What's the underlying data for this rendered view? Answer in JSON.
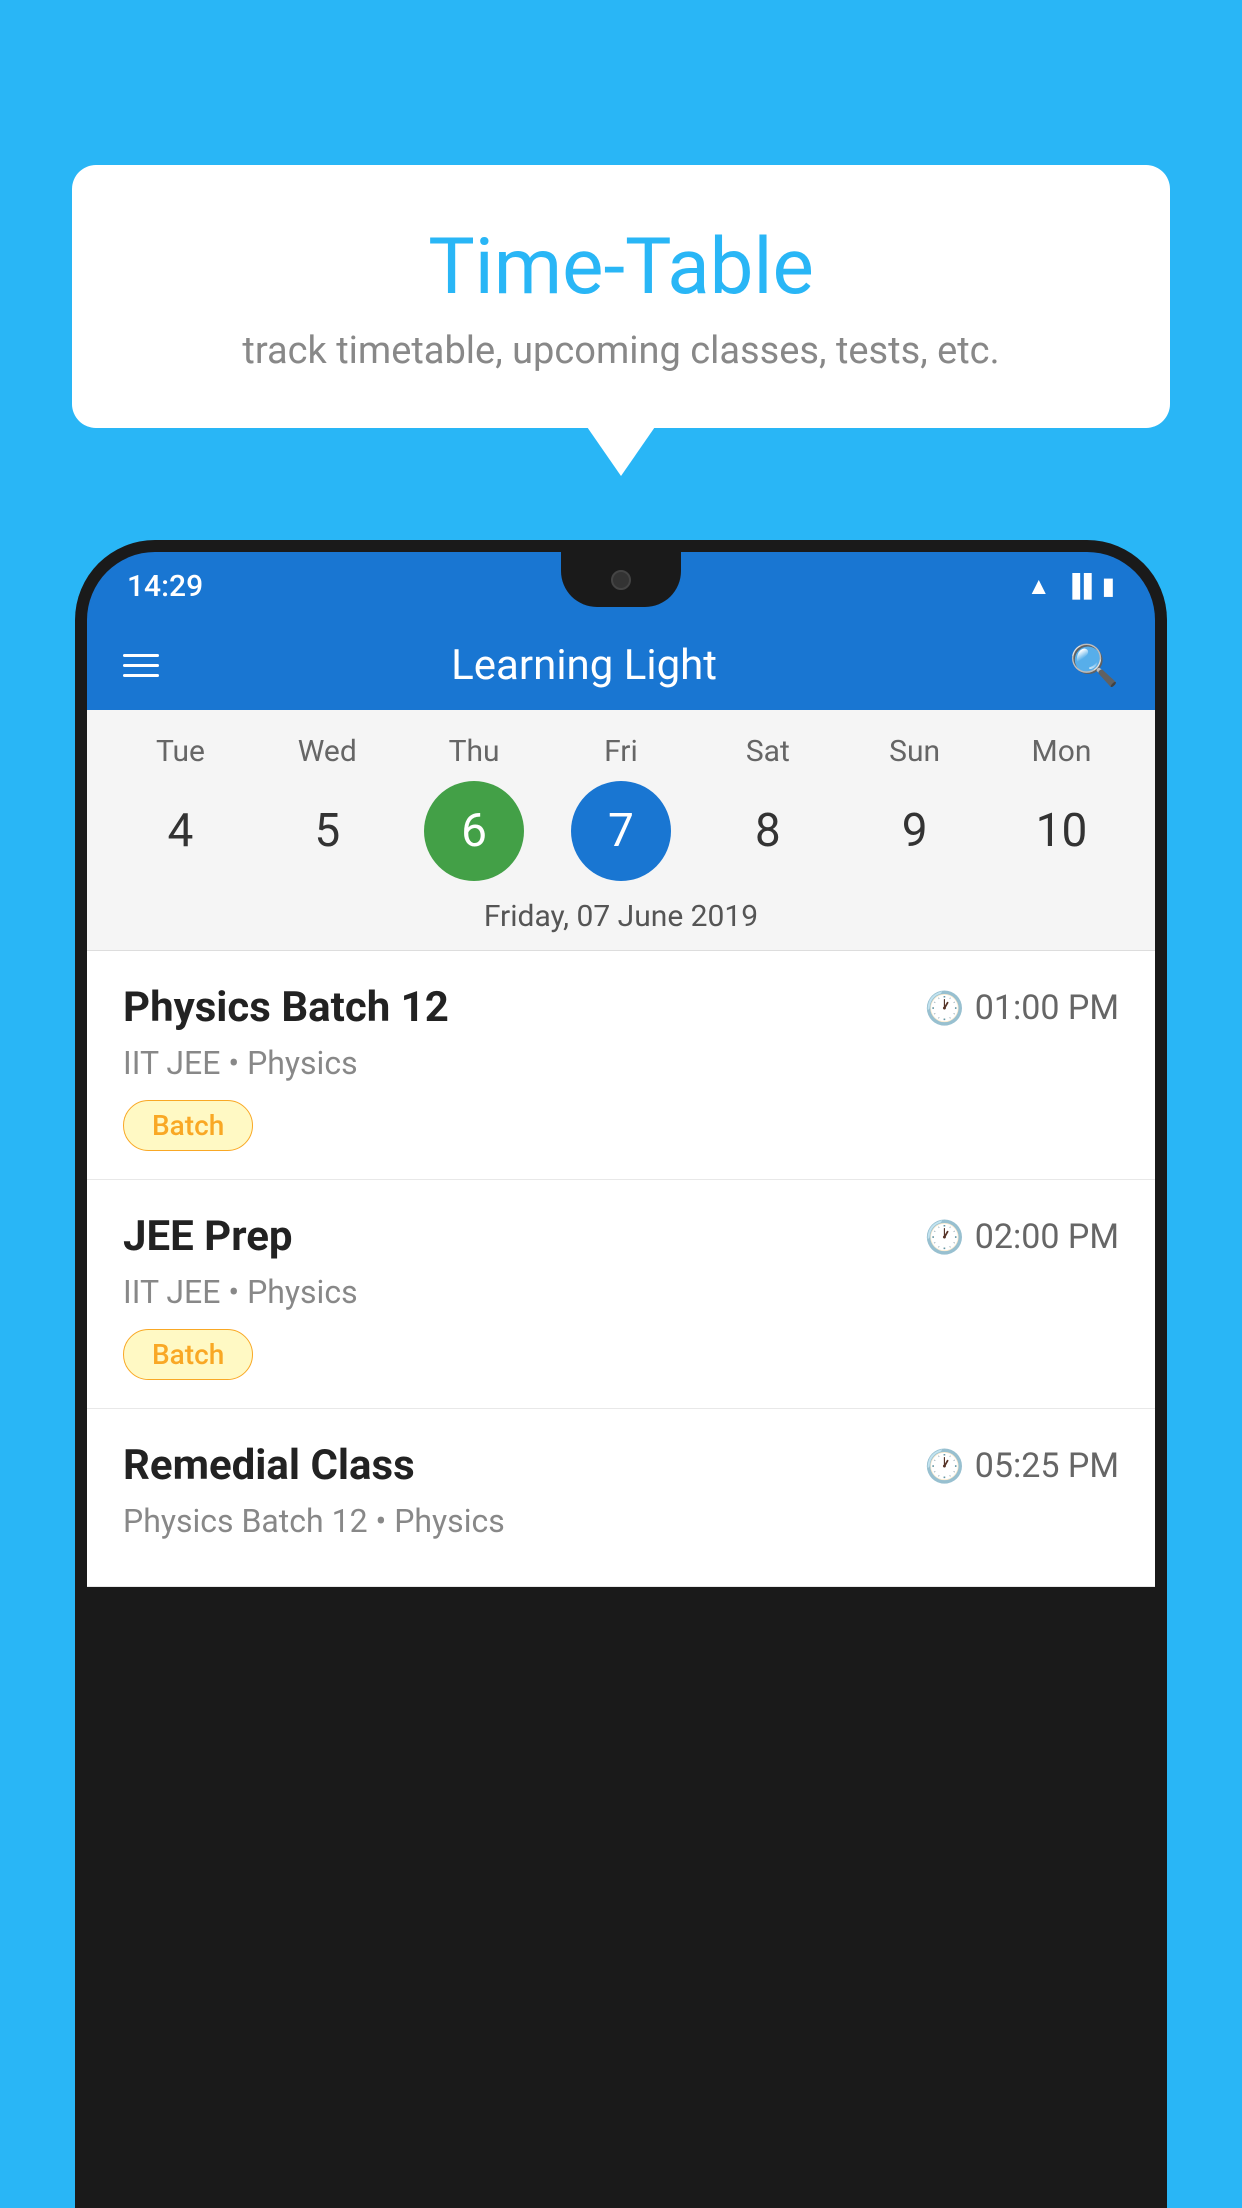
{
  "background": {
    "color": "#29B6F6"
  },
  "tooltip": {
    "title": "Time-Table",
    "subtitle": "track timetable, upcoming classes, tests, etc."
  },
  "phone": {
    "status_bar": {
      "time": "14:29"
    },
    "app_bar": {
      "title": "Learning Light"
    },
    "calendar": {
      "days": [
        {
          "label": "Tue",
          "number": "4",
          "state": "normal"
        },
        {
          "label": "Wed",
          "number": "5",
          "state": "normal"
        },
        {
          "label": "Thu",
          "number": "6",
          "state": "today"
        },
        {
          "label": "Fri",
          "number": "7",
          "state": "selected"
        },
        {
          "label": "Sat",
          "number": "8",
          "state": "normal"
        },
        {
          "label": "Sun",
          "number": "9",
          "state": "normal"
        },
        {
          "label": "Mon",
          "number": "10",
          "state": "normal"
        }
      ],
      "selected_date_label": "Friday, 07 June 2019"
    },
    "schedule": [
      {
        "title": "Physics Batch 12",
        "time": "01:00 PM",
        "subtitle": "IIT JEE • Physics",
        "badge": "Batch"
      },
      {
        "title": "JEE Prep",
        "time": "02:00 PM",
        "subtitle": "IIT JEE • Physics",
        "badge": "Batch"
      },
      {
        "title": "Remedial Class",
        "time": "05:25 PM",
        "subtitle": "Physics Batch 12 • Physics",
        "badge": null
      }
    ]
  }
}
